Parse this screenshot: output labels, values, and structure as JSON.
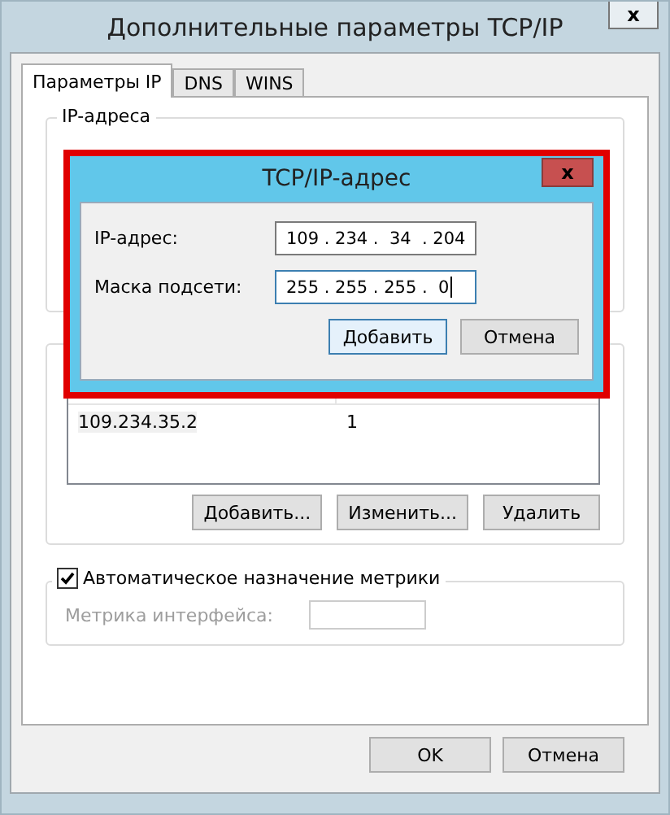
{
  "window": {
    "title": "Дополнительные параметры TCP/IP",
    "close": "x"
  },
  "tabs": [
    {
      "label": "Параметры IP",
      "selected": true
    },
    {
      "label": "DNS",
      "selected": false
    },
    {
      "label": "WINS",
      "selected": false
    }
  ],
  "ip_group": {
    "title": "IP-адреса"
  },
  "gateway_list": {
    "rows": [
      {
        "cells": [
          "109.234.35.2",
          "1"
        ],
        "selected": false
      }
    ]
  },
  "gateway_buttons": [
    "Добавить...",
    "Изменить...",
    "Удалить"
  ],
  "metric": {
    "auto_label": "Автоматическое назначение метрики",
    "checked": true,
    "field_label": "Метрика интерфейса:",
    "disabled": true
  },
  "buttons": [
    "OK",
    "Отмена"
  ],
  "dialog": {
    "title": "TCP/IP-адрес",
    "close": "x",
    "highlighted": true,
    "fields": [
      {
        "label": "IP-адрес:",
        "value": "109 . 234 .  34  . 204",
        "focused": false
      },
      {
        "label": "Маска подсети:",
        "value": "255 . 255 . 255 .  0",
        "focused": true
      }
    ],
    "buttons": [
      {
        "label": "Добавить",
        "default": true
      },
      {
        "label": "Отмена",
        "default": false
      }
    ]
  }
}
